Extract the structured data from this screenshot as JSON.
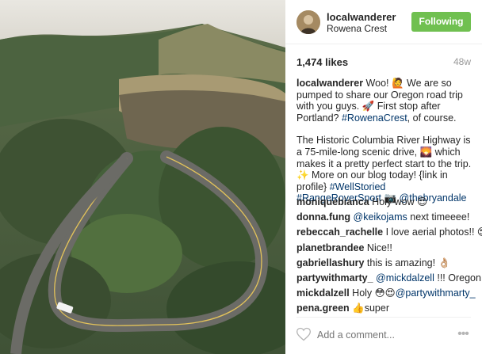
{
  "post": {
    "username": "localwanderer",
    "location": "Rowena Crest",
    "follow_label": "Following",
    "likes": "1,474 likes",
    "age": "48w",
    "photo_icon": "post-photo-aerial-winding-road"
  },
  "caption": {
    "username": "localwanderer",
    "p1_a": " Woo! 🙋 We are so pumped to share our Oregon road trip with you guys. 🚀 First stop after Portland? ",
    "p1_tag": "#RowenaCrest",
    "p1_b": ", of course.",
    "p2_a": "The Historic Columbia River Highway is a 75-mile-long scenic drive, 🌄 which makes it a pretty perfect start to the trip. ✨ More on our blog today! {link in profile}",
    "p2_tag1": "#WellStoried",
    "p2_tag2": "#RangeRoverSport",
    "p2_camera": " 📷",
    "p2_mention": "@thebryandale"
  },
  "comments": [
    {
      "user": "moniquebianca",
      "text": " Holy wow 😍"
    },
    {
      "user": "donna.fung",
      "mention": "@keikojams",
      "text": " next timeeee!"
    },
    {
      "user": "rebeccah_rachelle",
      "text": " I love aerial photos!! 😍"
    },
    {
      "user": "planetbrandee",
      "text": " Nice!!"
    },
    {
      "user": "gabriellashury",
      "text": " this is amazing! 👌🏼"
    },
    {
      "user": "partywithmarty_",
      "mention": "@mickdalzell",
      "text": " !!! Oregon"
    },
    {
      "user": "mickdalzell",
      "text_pre": " Holy 😳😍",
      "mention": "@partywithmarty_"
    },
    {
      "user": "pena.green",
      "text": " 👍super"
    }
  ],
  "footer": {
    "comment_placeholder": "Add a comment...",
    "like_icon": "heart-outline-icon",
    "more_icon": "more-options-icon",
    "more_glyph": "•••"
  },
  "colors": {
    "follow_button": "#70c050",
    "link": "#003569"
  }
}
